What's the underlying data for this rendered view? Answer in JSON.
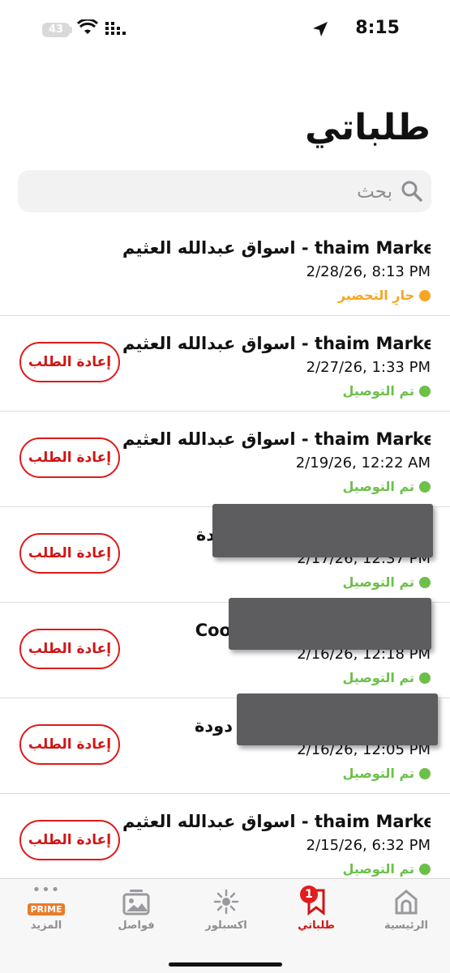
{
  "status_bar": {
    "time": "8:15",
    "battery": "43"
  },
  "header": {
    "title": "طلباتي"
  },
  "search": {
    "placeholder": "بحث"
  },
  "orders": [
    {
      "store": "اسواق عبدالله العثيم - thaim Market...",
      "date": "2/28/26, 8:13 PM",
      "status": "جارِ التحضير",
      "status_color": "#f5a623",
      "reorder": ""
    },
    {
      "store": "اسواق عبدالله العثيم - thaim Market...",
      "date": "2/27/26, 1:33 PM",
      "status": "تم التوصيل",
      "status_color": "#6cc04a",
      "reorder": "إعادة الطلب"
    },
    {
      "store": "اسواق عبدالله العثيم - thaim Market...",
      "date": "2/19/26, 12:22 AM",
      "status": "تم التوصيل",
      "status_color": "#6cc04a",
      "reorder": "إعادة الطلب"
    },
    {
      "store": "دة",
      "date": "2/17/26, 12:37 PM",
      "status": "تم التوصيل",
      "status_color": "#6cc04a",
      "reorder": "إعادة الطلب"
    },
    {
      "store": "Coo",
      "date": "2/16/26, 12:18 PM",
      "status": "تم التوصيل",
      "status_color": "#6cc04a",
      "reorder": "إعادة الطلب"
    },
    {
      "store": "دودة",
      "date": "2/16/26, 12:05 PM",
      "status": "تم التوصيل",
      "status_color": "#6cc04a",
      "reorder": "إعادة الطلب"
    },
    {
      "store": "اسواق عبدالله العثيم - thaim Market...",
      "date": "2/15/26, 6:32 PM",
      "status": "تم التوصيل",
      "status_color": "#6cc04a",
      "reorder": "إعادة الطلب"
    }
  ],
  "tabs": [
    {
      "label": "الرئيسية",
      "icon": "home-icon"
    },
    {
      "label": "طلباتي",
      "icon": "orders-icon",
      "badge": "1",
      "active": true
    },
    {
      "label": "اكسبلور",
      "icon": "explore-icon"
    },
    {
      "label": "فواصل",
      "icon": "gallery-icon"
    },
    {
      "label": "المزيد",
      "icon": "prime-more-icon",
      "prime": "PRIME"
    }
  ],
  "colors": {
    "accent": "#d01414",
    "delivered": "#6cc04a",
    "preparing": "#f5a623"
  }
}
